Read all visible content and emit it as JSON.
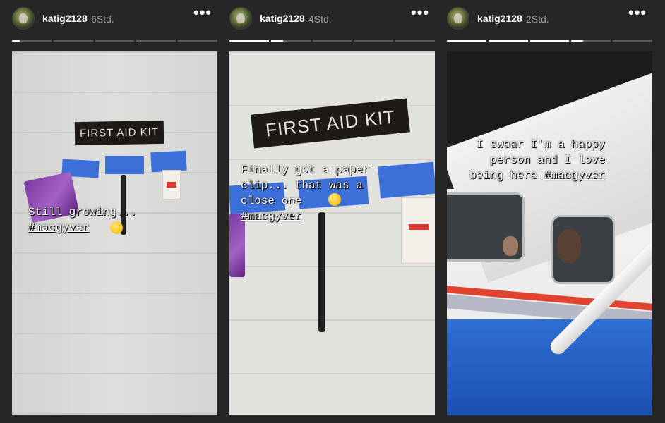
{
  "stories": [
    {
      "username": "katig2128",
      "time": "6Std.",
      "progress": [
        0.2,
        0,
        0,
        0,
        0
      ],
      "sign_text": "FIRST AID KIT",
      "caption_lines": [
        "Still growing...",
        "#macgyver"
      ]
    },
    {
      "username": "katig2128",
      "time": "4Std.",
      "progress": [
        1,
        0.3,
        0,
        0,
        0
      ],
      "sign_text": "FIRST AID KIT",
      "caption_lines": [
        "Finally got a paper",
        "clip... that was a",
        "close one",
        "#macgyver"
      ]
    },
    {
      "username": "katig2128",
      "time": "2Std.",
      "progress": [
        1,
        1,
        1,
        0.3,
        0
      ],
      "caption_lines": [
        "I swear I'm a happy",
        "person and I love",
        "being here #macgyver"
      ]
    }
  ],
  "icons": {
    "more": "more-options-icon",
    "avatar": "user-avatar"
  },
  "colors": {
    "background": "#262626",
    "progress_active": "#ffffff",
    "progress_inactive": "#5c5c5c",
    "tape": "#3c70d8"
  }
}
